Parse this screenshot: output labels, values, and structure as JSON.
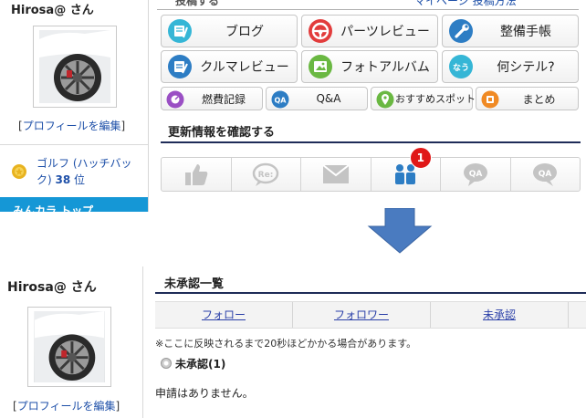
{
  "top": {
    "username": "Hirosa@ さん",
    "edit_open": "[",
    "edit_label": "プロフィールを編集",
    "edit_close": "]",
    "rank_model": "ゴルフ (ハッチバック)",
    "rank_value": "38",
    "rank_suffix": "位",
    "blue_bar_text": "みんカラ トップ",
    "strip_left": "投稿する",
    "strip_right": "マイページ 投稿方法",
    "buttons_big": [
      {
        "label": "ブログ",
        "icon": "blog-icon",
        "color": "#35b6d6"
      },
      {
        "label": "パーツレビュー",
        "icon": "steering-wheel-icon",
        "color": "#e23c3c"
      },
      {
        "label": "整備手帳",
        "icon": "wrench-icon",
        "color": "#2d7dc4"
      },
      {
        "label": "クルマレビュー",
        "icon": "car-review-icon",
        "color": "#2d7dc4"
      },
      {
        "label": "フォトアルバム",
        "icon": "photo-album-icon",
        "color": "#6ab842"
      },
      {
        "label": "何シテル?",
        "icon": "nani-shiteru-icon",
        "color": "#35b6d6"
      }
    ],
    "buttons_small": [
      {
        "label": "燃費記録",
        "icon": "fuel-icon",
        "color": "#9a4fc4"
      },
      {
        "label": "Q&A",
        "icon": "qa-icon",
        "color": "#2d7dc4"
      },
      {
        "label": "おすすめスポット",
        "icon": "spot-pin-icon",
        "color": "#6ab842"
      },
      {
        "label": "まとめ",
        "icon": "matome-icon",
        "color": "#f08a24"
      }
    ],
    "badge_icon_text": "なう",
    "qa_icon_text": "QA",
    "section_title": "更新情報を確認する",
    "notif_tabs": [
      {
        "icon": "thumbs-up-icon"
      },
      {
        "icon": "reply-icon",
        "text": "Re:"
      },
      {
        "icon": "mail-icon"
      },
      {
        "icon": "follow-people-icon",
        "badge": "1"
      },
      {
        "icon": "qa-bubble-icon",
        "text": "QA"
      },
      {
        "icon": "qa-bubble-alt-icon",
        "text": "QA"
      }
    ]
  },
  "bottom": {
    "username": "Hirosa@ さん",
    "edit_open": "[",
    "edit_label": "プロフィールを編集",
    "edit_close": "]",
    "section_title": "未承認一覧",
    "tabs": [
      "フォロー",
      "フォロワー",
      "未承認"
    ],
    "note": "※ここに反映されるまで20秒ほどかかる場合があります。",
    "radio_label": "未承認(1)",
    "empty_message": "申請はありません。"
  },
  "colors": {
    "accent_blue": "#1597d6",
    "link": "#1d4fa8",
    "arrow": "#4a7bc0",
    "rule": "#1f2c58",
    "badge": "#e01818"
  }
}
